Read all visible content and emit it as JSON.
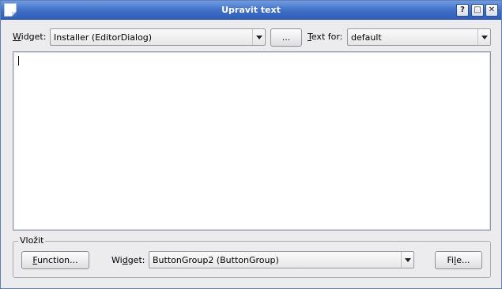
{
  "window": {
    "title": "Upravit text"
  },
  "titlebar_buttons": {
    "help": "?",
    "maximize": "□",
    "close": "✕"
  },
  "top_row": {
    "widget_label_u": "W",
    "widget_label_rest": "idget:",
    "widget_value": "Installer (EditorDialog)",
    "browse_button": "...",
    "textfor_label_u": "T",
    "textfor_label_rest": "ext for:",
    "textfor_value": "default"
  },
  "editor": {
    "content": ""
  },
  "insert_group": {
    "title": "Vložit",
    "function_button_u": "F",
    "function_button_rest": "unction...",
    "widget_label_pre": "Wi",
    "widget_label_u": "d",
    "widget_label_post": "get:",
    "widget_value": "ButtonGroup2 (ButtonGroup)",
    "file_button_pre": "Fi",
    "file_button_u": "l",
    "file_button_post": "e..."
  }
}
